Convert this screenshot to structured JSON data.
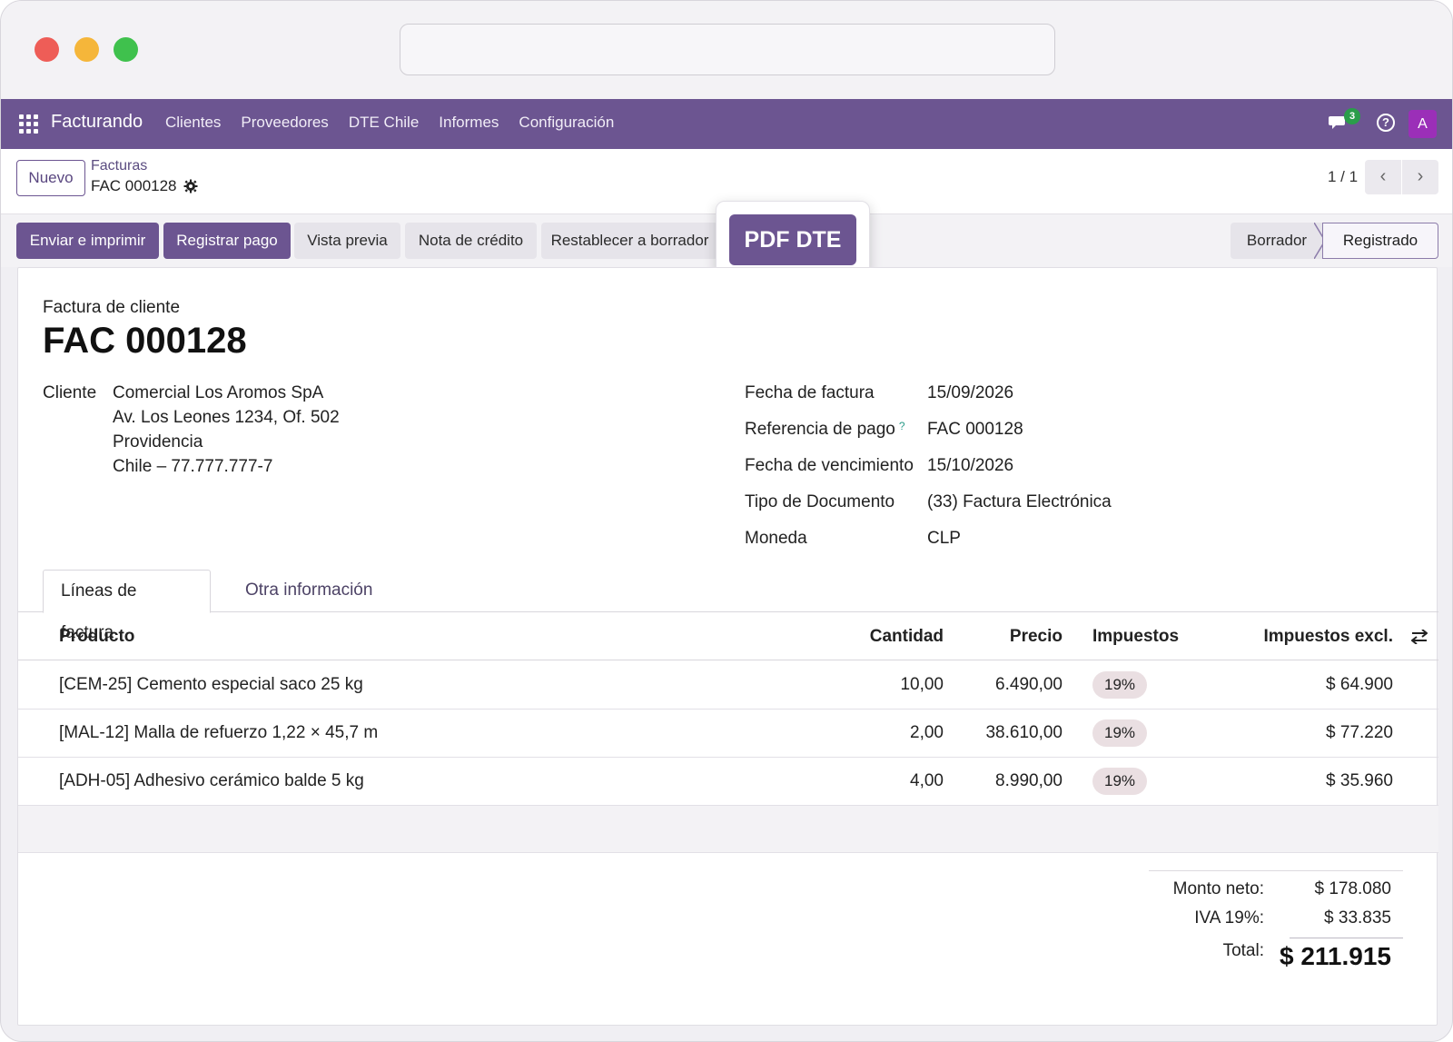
{
  "navbar": {
    "brand": "Facturando",
    "menu": [
      "Clientes",
      "Proveedores",
      "DTE Chile",
      "Informes",
      "Configuración"
    ],
    "messages_badge": "3",
    "help_glyph": "?",
    "avatar_initial": "A",
    "color": "#6c5591"
  },
  "control": {
    "new_label": "Nuevo",
    "breadcrumb_parent": "Facturas",
    "breadcrumb_current": "FAC 000128",
    "pager": "1 / 1"
  },
  "actions": {
    "send_print": "Enviar e imprimir",
    "register_payment": "Registrar pago",
    "preview": "Vista previa",
    "credit_note": "Nota de crédito",
    "reset_draft": "Restablecer a borrador",
    "pdf_dte": "PDF DTE"
  },
  "status": {
    "draft": "Borrador",
    "posted": "Registrado",
    "current": "Registrado"
  },
  "invoice": {
    "doc_type": "Factura de cliente",
    "name": "FAC 000128",
    "customer_label": "Cliente",
    "customer_lines": [
      "Comercial Los Aromos SpA",
      "Av. Los Leones 1234, Of. 502",
      "Providencia",
      "Chile – 77.777.777-7"
    ],
    "fields": [
      {
        "label": "Fecha de factura",
        "value": "15/09/2026"
      },
      {
        "label": "Referencia de pago",
        "value": "FAC 000128",
        "help": "?"
      },
      {
        "label": "Fecha de vencimiento",
        "value": "15/10/2026"
      },
      {
        "label": "Tipo de Documento",
        "value": "(33) Factura Electrónica"
      },
      {
        "label": "Moneda",
        "value": "CLP"
      }
    ]
  },
  "tabs": [
    "Líneas de factura",
    "Otra información"
  ],
  "lines": {
    "headers": {
      "product": "Producto",
      "qty": "Cantidad",
      "price": "Precio",
      "taxes": "Impuestos",
      "subtotal": "Impuestos excl."
    },
    "rows": [
      {
        "product": "[CEM-25] Cemento especial saco 25 kg",
        "qty": "10,00",
        "price": "6.490,00",
        "tax": "19%",
        "subtotal": "$ 64.900"
      },
      {
        "product": "[MAL-12] Malla de refuerzo 1,22 × 45,7 m",
        "qty": "2,00",
        "price": "38.610,00",
        "tax": "19%",
        "subtotal": "$ 77.220"
      },
      {
        "product": "[ADH-05] Adhesivo cerámico balde 5 kg",
        "qty": "4,00",
        "price": "8.990,00",
        "tax": "19%",
        "subtotal": "$ 35.960"
      }
    ]
  },
  "totals": {
    "net_label": "Monto neto:",
    "net_value": "$ 178.080",
    "vat_label": "IVA 19%:",
    "vat_value": "$ 33.835",
    "total_label": "Total:",
    "total_value": "$ 211.915"
  }
}
